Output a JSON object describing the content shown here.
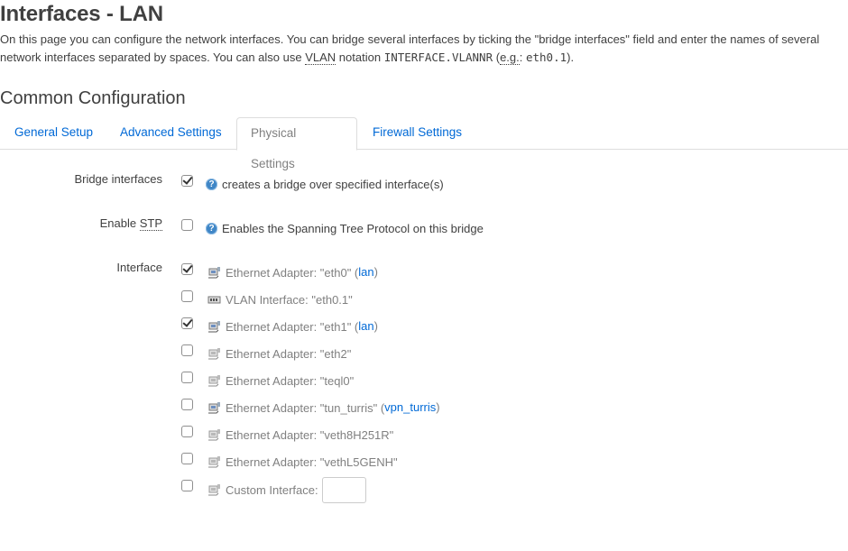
{
  "page": {
    "title": "Interfaces - LAN",
    "description": {
      "part1": "On this page you can configure the network interfaces. You can bridge several interfaces by ticking the \"bridge interfaces\" field and enter the names of several network interfaces separated by spaces. You can also use ",
      "vlan": "VLAN",
      "part2": " notation ",
      "code": "INTERFACE.VLANNR",
      "part3": " (",
      "eg": "e.g.",
      "part4": ": ",
      "example": "eth0.1",
      "part5": ")."
    }
  },
  "section": {
    "title": "Common Configuration"
  },
  "tabs": [
    {
      "label": "General Setup"
    },
    {
      "label": "Advanced Settings"
    },
    {
      "label": "Physical Settings",
      "active": true
    },
    {
      "label": "Firewall Settings"
    }
  ],
  "bridge": {
    "label": "Bridge interfaces",
    "checked": true,
    "help": "creates a bridge over specified interface(s)"
  },
  "stp": {
    "label_prefix": "Enable ",
    "label_abbr": "STP",
    "checked": false,
    "help": "Enables the Spanning Tree Protocol on this bridge"
  },
  "interface": {
    "label": "Interface",
    "items": [
      {
        "text": "Ethernet Adapter: \"eth0\" (",
        "network": "lan",
        "suffix": ")",
        "checked": true,
        "icon": "ethernet-icon"
      },
      {
        "text": "VLAN Interface: \"eth0.1\"",
        "checked": false,
        "icon": "vlan-icon"
      },
      {
        "text": "Ethernet Adapter: \"eth1\" (",
        "network": "lan",
        "suffix": ")",
        "checked": true,
        "icon": "ethernet-icon"
      },
      {
        "text": "Ethernet Adapter: \"eth2\"",
        "checked": false,
        "icon": "ethernet-icon"
      },
      {
        "text": "Ethernet Adapter: \"teql0\"",
        "checked": false,
        "icon": "ethernet-icon"
      },
      {
        "text": "Ethernet Adapter: \"tun_turris\" (",
        "network": "vpn_turris",
        "suffix": ")",
        "checked": false,
        "icon": "ethernet-icon"
      },
      {
        "text": "Ethernet Adapter: \"veth8H251R\"",
        "checked": false,
        "icon": "ethernet-icon"
      },
      {
        "text": "Ethernet Adapter: \"vethL5GENH\"",
        "checked": false,
        "icon": "ethernet-icon"
      }
    ],
    "custom": {
      "label": "Custom Interface:",
      "value": "",
      "checked": false
    }
  },
  "colors": {
    "link": "#0069d6",
    "text": "#404040",
    "muted": "#808080",
    "help": "#3f86c6"
  }
}
